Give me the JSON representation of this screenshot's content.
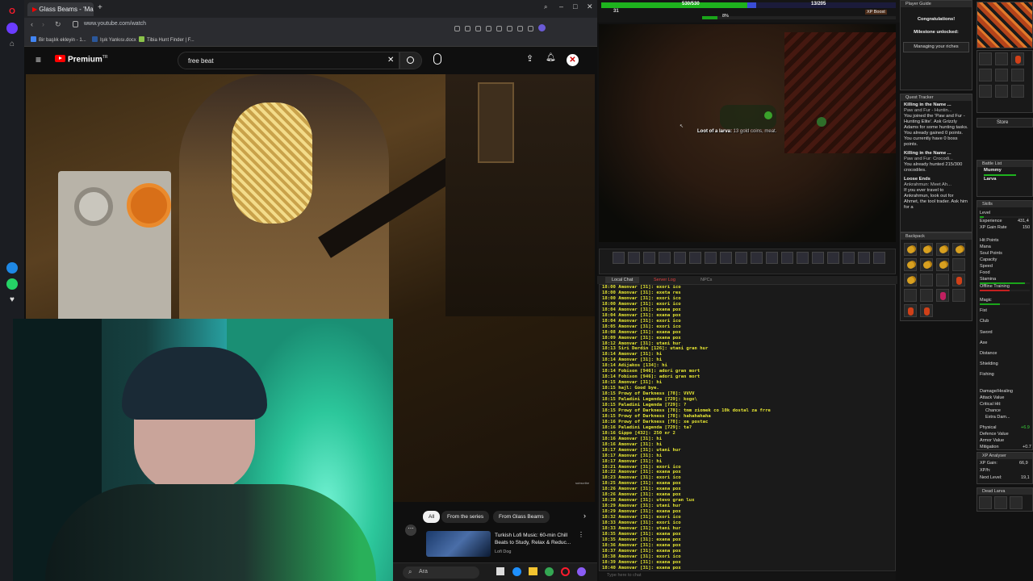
{
  "browser": {
    "tab_title": "Glass Beams - 'Mahal",
    "url": "www.youtube.com/watch",
    "bookmarks": [
      "Bir başlık ekleyin - 1...",
      "Işık Yankısı.docx",
      "Tibia Hunt Finder | F..."
    ]
  },
  "youtube": {
    "logo": "Premium",
    "logo_sup": "TR",
    "search_value": "free beat",
    "chips": [
      "All",
      "From the series",
      "From Glass Beams"
    ],
    "recommended": {
      "title": "Turkish Lofi Music: 60-min Chill Beats to Study, Relax & Reduc...",
      "channel": "Lofi Dog"
    },
    "video_watermark": "subscribe"
  },
  "taskbar": {
    "search_placeholder": "Ara"
  },
  "tibia": {
    "hp": "530/530",
    "mana": "13/205",
    "level": "31",
    "xp_percent_label": "8%",
    "xp_percent": 8,
    "xp_boost": "XP Boost",
    "loot_prefix": "Loot of a larva:",
    "loot_items": " 13 gold coins, meat.",
    "chat_tabs": [
      "Local Chat",
      "Server Log",
      "NPCs"
    ],
    "chat_input_placeholder": "Type here to chat",
    "chat_lines": [
      "18:00 Amonvar [31]: exori ico",
      "18:00 Amonvar [31]: exeta res",
      "18:00 Amonvar [31]: exori ico",
      "18:00 Amonvar [31]: exori ico",
      "18:04 Amonvar [31]: exana pox",
      "18:04 Amonvar [31]: exana pox",
      "18:04 Amonvar [31]: exori ico",
      "18:05 Amonvar [31]: exori ico",
      "18:08 Amonvar [31]: exana pox",
      "18:09 Amonvar [31]: exana pox",
      "18:12 Amonvar [31]: utani hur",
      "18:13 Siri Derdin [126]: utani gran hur",
      "18:14 Amonvar [31]: hi",
      "18:14 Amonvar [31]: hi",
      "18:14 Adijakos [134]: hi",
      "18:14 Fobison [946]: adori gran mort",
      "18:14 Fobison [946]: adori gran mort",
      "18:15 Amonvar [31]: hi",
      "18:15 hajl: Good bye.",
      "18:15 Prowy of Darkness [78]: VVVV",
      "18:15 Paladini Legenda [729]: kogo\\",
      "18:15 Paladini Legenda [729]: ?",
      "18:15 Prowy of Darkness [78]: tmm ziomek co 10k dostal za frre",
      "18:15 Prowy of Darkness [78]: hahahahaha",
      "18:16 Prowy of Darkness [78]: xe postac",
      "18:16 Paladini Legenda [729]: ta?",
      "18:16 Gippo [432]: 250 nr 2",
      "18:16 Amonvar [31]: hi",
      "18:16 Amonvar [31]: hi",
      "18:17 Amonvar [31]: utani hur",
      "18:17 Amonvar [31]: hi",
      "18:17 Amonvar [31]: hi",
      "18:21 Amonvar [31]: exori ico",
      "18:22 Amonvar [31]: exana pox",
      "18:23 Amonvar [31]: exori ico",
      "18:25 Amonvar [31]: exana pox",
      "18:26 Amonvar [31]: exana pox",
      "18:26 Amonvar [31]: exana pox",
      "18:28 Amonvar [31]: utevo gran lux",
      "18:29 Amonvar [31]: utani hur",
      "18:29 Amonvar [31]: exana pox",
      "18:32 Amonvar [31]: exori ico",
      "18:33 Amonvar [31]: exori ico",
      "18:33 Amonvar [31]: utani hur",
      "18:35 Amonvar [31]: exana pox",
      "18:35 Amonvar [31]: exana pox",
      "18:36 Amonvar [31]: exana pox",
      "18:37 Amonvar [31]: exana pox",
      "18:38 Amonvar [31]: exori ico",
      "18:39 Amonvar [31]: exana pox",
      "18:40 Amonvar [31]: exana pox",
      "18:41 Amonvar [31]: exana pox"
    ],
    "player_guide": {
      "title": "Player Guide",
      "congrats": "Congratulations!",
      "milestone": "Milestone unlocked:",
      "detail": "Managing your riches"
    },
    "quest_tracker": {
      "title": "Quest Tracker",
      "q1_name": "Killing in the Name ...",
      "q1_sub": "Paw and Fur - Huntin...",
      "q1_text": "You joined the 'Paw and Fur - Hunting Elite'. Ask Grizzly Adams for some hunting tasks. You already gained 0 points. You currently have 0 boss points.",
      "q2_name": "Killing in the Name ...",
      "q2_sub": "Paw and Fur: Crocodi...",
      "q2_text": "You already hunted 215/300 crocodiles.",
      "q3_name": "Loose Ends",
      "q3_sub": "Ankrahmun: Meet Ah...",
      "q3_text": "If you ever travel to Ankrahmun, look out for Ahmet, the tool trader. Ask him for a"
    },
    "backpack_title": "Backpack",
    "store_label": "Store",
    "battle": {
      "title": "Battle List",
      "entries": [
        "Mummy",
        "Larva"
      ]
    },
    "skills": {
      "title": "Skills",
      "level_label": "Level",
      "experience_label": "Experience",
      "experience_value": "431,4",
      "xp_gain_label": "XP Gain Rate",
      "xp_gain_value": "150",
      "hit_points_label": "Hit Points",
      "mana_label": "Mana",
      "soul_label": "Soul Points",
      "capacity_label": "Capacity",
      "speed_label": "Speed",
      "food_label": "Food",
      "stamina_label": "Stamina",
      "offline_label": "Offline Training",
      "magic_label": "Magic",
      "fist_label": "Fist",
      "club_label": "Club",
      "sword_label": "Sword",
      "axe_label": "Axe",
      "distance_label": "Distance",
      "shielding_label": "Shielding",
      "fishing_label": "Fishing",
      "damage_label": "Damage/Healing",
      "attack_label": "Attack Value",
      "critical_label": "Critical Hit:",
      "chance_label": "Chance",
      "extra_label": "Extra Dam...",
      "physical_label": "Physical",
      "defence_label": "Defence Value",
      "armor_label": "Armor Value",
      "mitigation_label": "Mitigation",
      "physical_value": "+6.9",
      "mitigation_value": "+0.7"
    },
    "xp_analyser": {
      "title": "XP Analyser",
      "gain_label": "XP Gain:",
      "gain_value": "66,9",
      "rate_label": "XP/h:",
      "next_label": "Next Level:",
      "next_value": "19,1"
    },
    "dead_title": "Dead Larva"
  }
}
